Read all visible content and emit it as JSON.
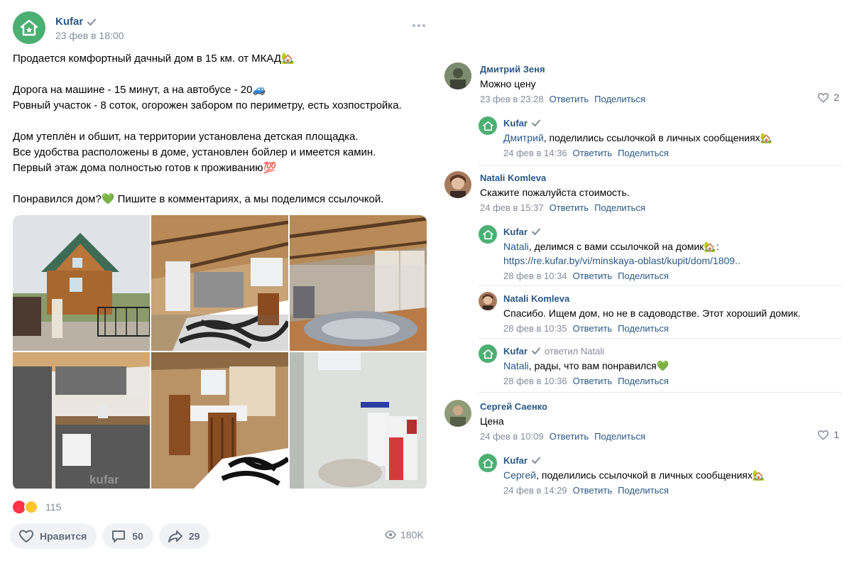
{
  "post": {
    "author": "Kufar",
    "date": "23 фев в 18:00",
    "text": [
      "Продается комфортный дачный дом в 15 км. от МКАД🏡",
      "",
      "Дорога на машине - 15 минут, а на автобусе - 20🚙",
      "Ровный участок - 8 соток, огорожен забором по периметру, есть хозпостройка.",
      "",
      "Дом утеплён и обшит, на территории установлена детская площадка.",
      "Все удобства расположены в доме, установлен бойлер и имеется камин.",
      "Первый этаж дома полностью готов к проживанию💯",
      "",
      "Понравился дом?💚 Пишите в комментариях, а мы поделимся ссылочкой."
    ],
    "photo_watermark": "kufar",
    "reactions_count": "115",
    "like_label": "Нравится",
    "comments_count": "50",
    "shares_count": "29",
    "views": "180K"
  },
  "comments": [
    {
      "author": "Дмитрий Зеня",
      "text": "Можно цену",
      "date": "23 фев в 23:28",
      "reply_label": "Ответить",
      "share_label": "Поделиться",
      "likes": "2"
    },
    {
      "author": "Kufar",
      "mention": "Дмитрий",
      "text": ", поделились ссылочкой в личных сообщениях🏡",
      "date": "24 фев в 14:36",
      "reply_label": "Ответить",
      "share_label": "Поделиться"
    },
    {
      "author": "Natali Komleva",
      "text": "Скажите пожалуйста стоимость.",
      "date": "24 фев в 15:37",
      "reply_label": "Ответить",
      "share_label": "Поделиться"
    },
    {
      "author": "Kufar",
      "mention": "Natali",
      "text": ", делимся с вами ссылочкой на домик🏡:",
      "link": "https://re.kufar.by/vi/minskaya-oblast/kupit/dom/1809..",
      "date": "28 фев в 10:34",
      "reply_label": "Ответить",
      "share_label": "Поделиться"
    },
    {
      "author": "Natali Komleva",
      "text": "Спасибо. Ищем дом, но не в садоводстве. Этот хороший домик.",
      "date": "28 фев в 10:35",
      "reply_label": "Ответить",
      "share_label": "Поделиться"
    },
    {
      "author": "Kufar",
      "replied_to": "ответил Natali",
      "mention": "Natali",
      "text": ", рады, что вам понравился💚",
      "date": "28 фев в 10:36",
      "reply_label": "Ответить",
      "share_label": "Поделиться"
    },
    {
      "author": "Сергей Саенко",
      "text": "Цена",
      "date": "24 фев в 10:09",
      "reply_label": "Ответить",
      "share_label": "Поделиться",
      "likes": "1"
    },
    {
      "author": "Kufar",
      "mention": "Сергей",
      "text": ", поделились ссылочкой в личных сообщениях🏡",
      "date": "24 фев в 14:29",
      "reply_label": "Ответить",
      "share_label": "Поделиться"
    }
  ],
  "colors": {
    "brand_green": "#4caf72",
    "link_blue": "#2a5885",
    "muted": "#818c99"
  }
}
